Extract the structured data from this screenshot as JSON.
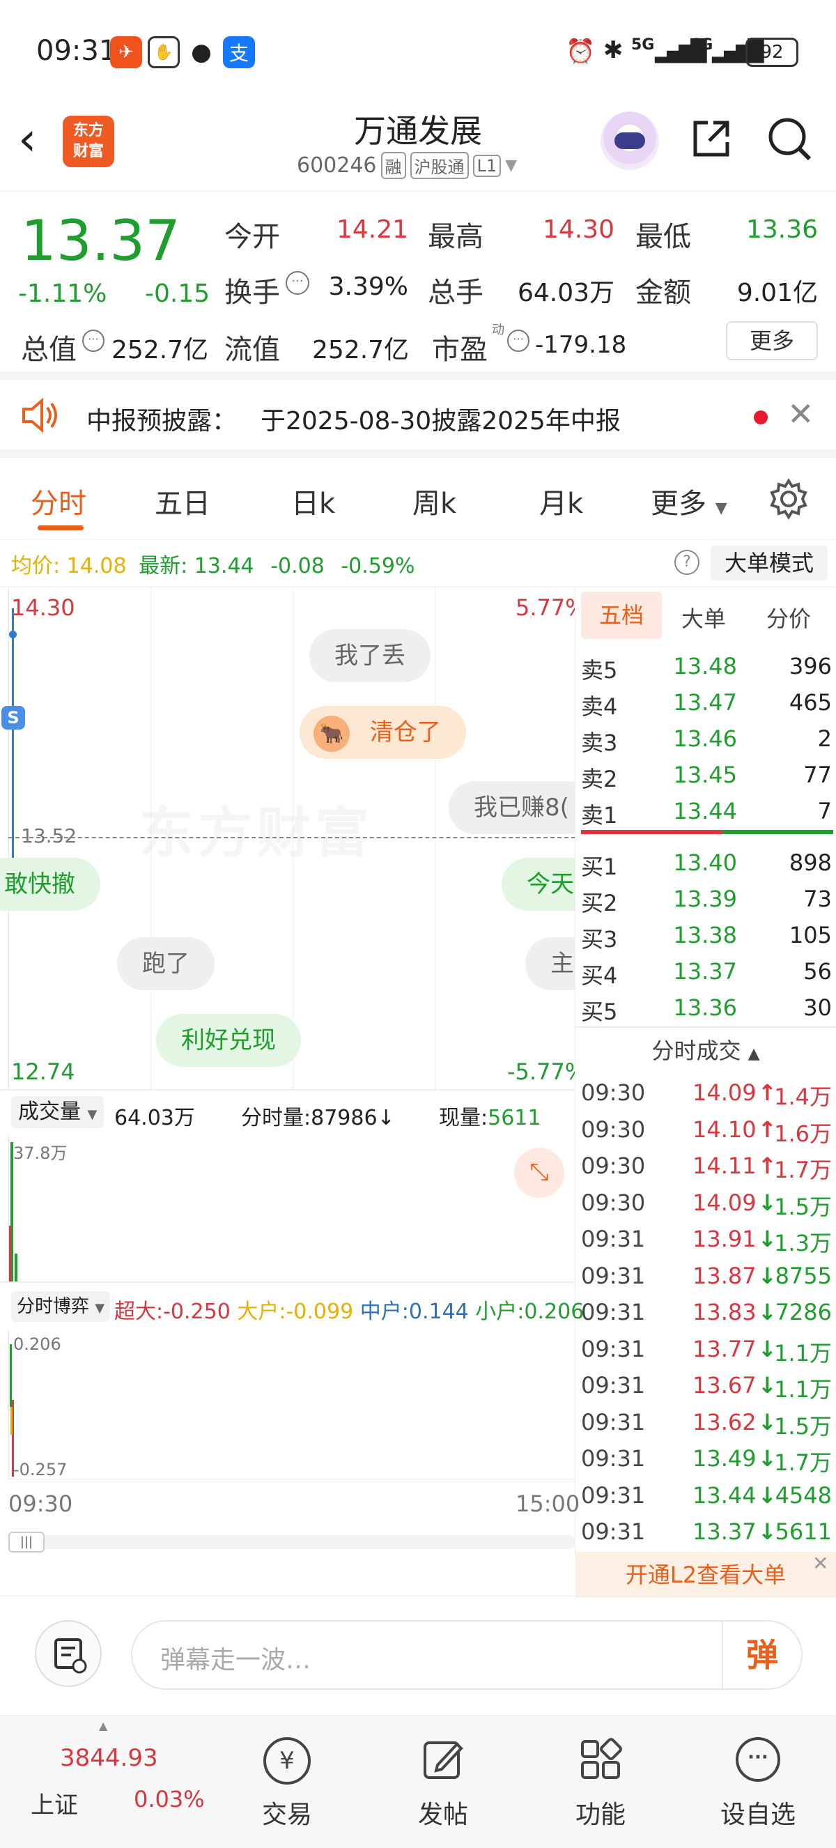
{
  "status_bar": {
    "time": "09:31",
    "network_5g": "5G",
    "network_4g": "4G",
    "battery": "92",
    "alipay_char": "支"
  },
  "header": {
    "logo_line1": "东方",
    "logo_line2": "财富",
    "stock_name": "万通发展",
    "stock_code": "600246",
    "tag_margin": "融",
    "tag_connect": "沪股通",
    "tag_level": "L1"
  },
  "quote": {
    "price": "13.37",
    "change_pct": "-1.11%",
    "change": "-0.15",
    "open_label": "今开",
    "open": "14.21",
    "high_label": "最高",
    "high": "14.30",
    "low_label": "最低",
    "low": "13.36",
    "turnover_label": "换手",
    "turnover": "3.39%",
    "volume_label": "总手",
    "volume": "64.03万",
    "amount_label": "金额",
    "amount": "9.01亿",
    "mktcap_label": "总值",
    "mktcap": "252.7亿",
    "float_label": "流值",
    "float": "252.7亿",
    "pe_label": "市盈",
    "pe_sup": "动",
    "pe": "-179.18",
    "more_label": "更多"
  },
  "notice": {
    "label": "中报预披露：",
    "text": "于2025-08-30披露2025年中报"
  },
  "tabs": {
    "items": [
      "分时",
      "五日",
      "日k",
      "周k",
      "月k",
      "更多"
    ],
    "active": 0
  },
  "avg_bar": {
    "avg_label": "均价:",
    "avg": "14.08",
    "latest_label": "最新:",
    "latest": "13.44",
    "chg": "-0.08",
    "chg_pct": "-0.59%",
    "mode_label": "大单模式"
  },
  "chart": {
    "top_price": "14.30",
    "top_pct": "5.77%",
    "bottom_price": "12.74",
    "bottom_pct": "-5.77%",
    "ref_price": "13.52",
    "watermark": "东方财富",
    "start_time": "09:30",
    "end_time": "15:00"
  },
  "danmu": [
    {
      "text": "我了丢"
    },
    {
      "text": "清仓了"
    },
    {
      "text": "我已赚8("
    },
    {
      "text": "敢快撤"
    },
    {
      "text": "今天"
    },
    {
      "text": "跑了"
    },
    {
      "text": "主"
    },
    {
      "text": "利好兑现"
    }
  ],
  "volume": {
    "label": "成交量",
    "total": "64.03万",
    "fenshi_label": "分时量:",
    "fenshi": "87986",
    "now_label": "现量:",
    "now": "5611",
    "max_label": "37.8万"
  },
  "game": {
    "label": "分时博弈",
    "xl_label": "超大:",
    "xl": "-0.250",
    "l_label": "大户:",
    "l": "-0.099",
    "m_label": "中户:",
    "m": "0.144",
    "s_label": "小户:",
    "s": "0.206",
    "max": "0.206",
    "min": "-0.257"
  },
  "panel": {
    "tabs": [
      "五档",
      "大单",
      "分价"
    ],
    "sells": [
      {
        "label": "卖5",
        "price": "13.48",
        "vol": "396"
      },
      {
        "label": "卖4",
        "price": "13.47",
        "vol": "465"
      },
      {
        "label": "卖3",
        "price": "13.46",
        "vol": "2"
      },
      {
        "label": "卖2",
        "price": "13.45",
        "vol": "77"
      },
      {
        "label": "卖1",
        "price": "13.44",
        "vol": "7"
      }
    ],
    "buys": [
      {
        "label": "买1",
        "price": "13.40",
        "vol": "898"
      },
      {
        "label": "买2",
        "price": "13.39",
        "vol": "73"
      },
      {
        "label": "买3",
        "price": "13.38",
        "vol": "105"
      },
      {
        "label": "买4",
        "price": "13.37",
        "vol": "56"
      },
      {
        "label": "买5",
        "price": "13.36",
        "vol": "30"
      }
    ],
    "trades_title": "分时成交",
    "trades": [
      {
        "time": "09:30",
        "price": "14.09",
        "dir": "up",
        "vol": "1.4万"
      },
      {
        "time": "09:30",
        "price": "14.10",
        "dir": "up",
        "vol": "1.6万"
      },
      {
        "time": "09:30",
        "price": "14.11",
        "dir": "up",
        "vol": "1.7万"
      },
      {
        "time": "09:30",
        "price": "14.09",
        "dir": "down",
        "vol": "1.5万"
      },
      {
        "time": "09:31",
        "price": "13.91",
        "dir": "down",
        "vol": "1.3万"
      },
      {
        "time": "09:31",
        "price": "13.87",
        "dir": "down",
        "vol": "8755"
      },
      {
        "time": "09:31",
        "price": "13.83",
        "dir": "down",
        "vol": "7286"
      },
      {
        "time": "09:31",
        "price": "13.77",
        "dir": "down",
        "vol": "1.1万"
      },
      {
        "time": "09:31",
        "price": "13.67",
        "dir": "down",
        "vol": "1.1万"
      },
      {
        "time": "09:31",
        "price": "13.62",
        "dir": "down",
        "vol": "1.5万"
      },
      {
        "time": "09:31",
        "price": "13.49",
        "dir": "down",
        "vol": "1.7万"
      },
      {
        "time": "09:31",
        "price": "13.44",
        "dir": "down",
        "vol": "4548"
      },
      {
        "time": "09:31",
        "price": "13.37",
        "dir": "down",
        "vol": "5611"
      }
    ],
    "l2_banner": "开通L2查看大单"
  },
  "comment": {
    "placeholder": "弹幕走一波…",
    "send_label": "弹"
  },
  "bottom_nav": {
    "index_value": "3844.93",
    "index_name": "上证",
    "index_pct": "0.03%",
    "items": [
      "交易",
      "发帖",
      "功能",
      "设自选"
    ]
  },
  "colors": {
    "up": "#d9363e",
    "down": "#1f9d2f",
    "accent": "#e8601c",
    "price_line": "#2e7bd6"
  }
}
